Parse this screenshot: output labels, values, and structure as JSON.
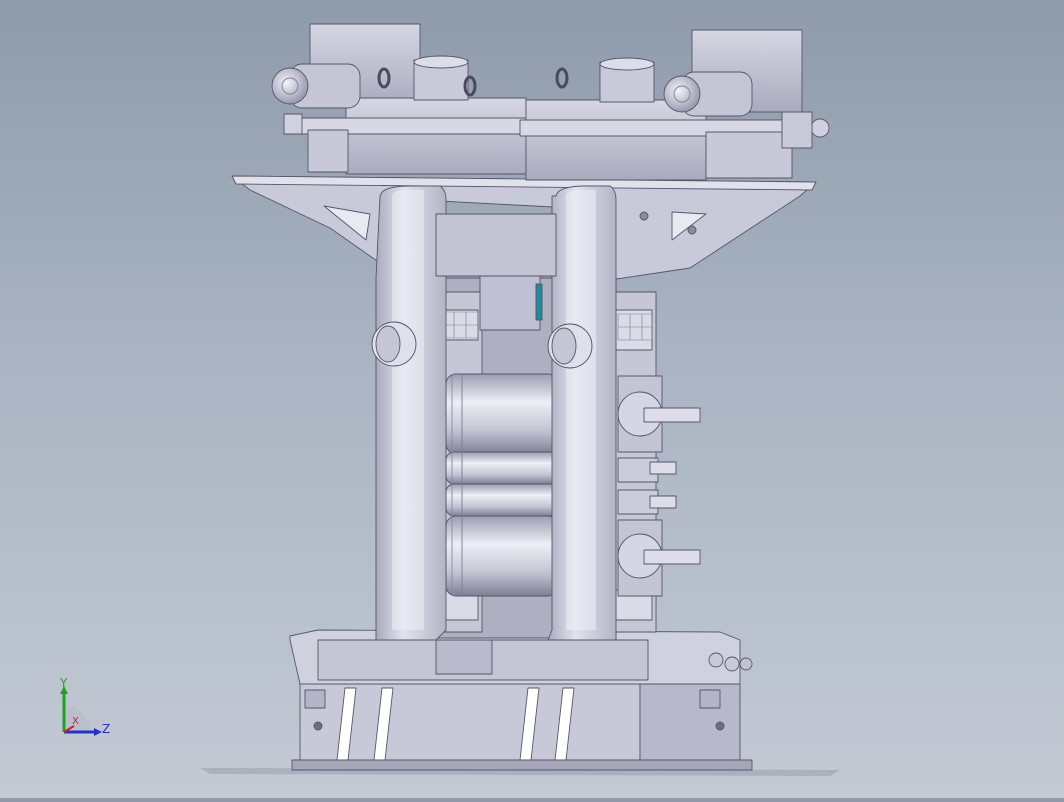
{
  "viewport": {
    "model": "rolling-mill-stand",
    "colors": {
      "background_top": "#8f9bab",
      "background_bottom": "#c3cad4",
      "part_light": "#d4d5e2",
      "part_mid": "#b4b5c6",
      "part_dark": "#8e8fa3",
      "edge": "#55566a",
      "accent_teal": "#1e8c9a"
    }
  },
  "triad": {
    "x_label": "X",
    "y_label": "Y",
    "z_label": "Z",
    "x_color": "#d22020",
    "y_color": "#1fa31f",
    "z_color": "#2233cc"
  }
}
